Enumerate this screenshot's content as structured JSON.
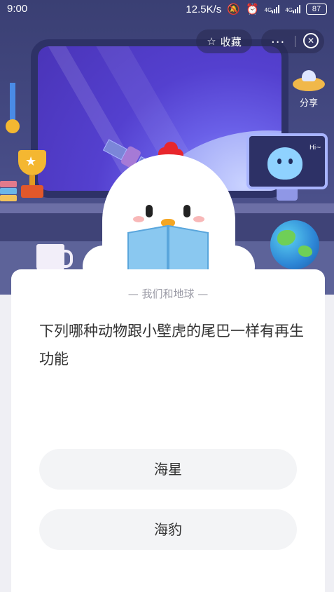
{
  "status_bar": {
    "time": "9:00",
    "network_speed": "12.5K/s",
    "signal1_label": "4G",
    "signal2_label": "4G",
    "battery": "87"
  },
  "header": {
    "favorite_label": "收藏",
    "share_label": "分享",
    "menu_label": "···"
  },
  "illustration": {
    "monitor_text": "Hi~"
  },
  "question_card": {
    "category": "— 我们和地球 —",
    "question": "下列哪种动物跟小壁虎的尾巴一样有再生功能",
    "options": [
      {
        "label": "海星"
      },
      {
        "label": "海豹"
      }
    ]
  },
  "icons": {
    "favorite": "star-outline-icon",
    "more": "more-dots-icon",
    "close": "close-circle-icon",
    "share": "ufo-share-icon",
    "alarm": "alarm-icon",
    "mute": "bell-off-icon"
  }
}
